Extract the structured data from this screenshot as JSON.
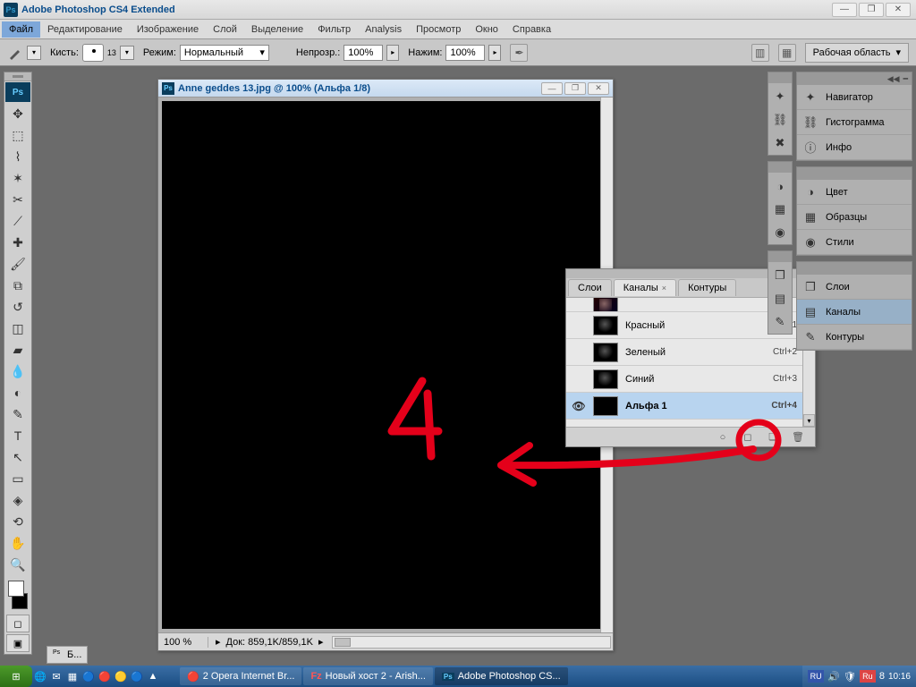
{
  "app": {
    "title": "Adobe Photoshop CS4 Extended"
  },
  "menu": [
    "Файл",
    "Редактирование",
    "Изображение",
    "Слой",
    "Выделение",
    "Фильтр",
    "Analysis",
    "Просмотр",
    "Окно",
    "Справка"
  ],
  "options": {
    "brush_label": "Кисть:",
    "brush_size": "13",
    "mode_label": "Режим:",
    "mode_value": "Нормальный",
    "opacity_label": "Непрозр.:",
    "opacity_value": "100%",
    "flow_label": "Нажим:",
    "flow_value": "100%",
    "workspace": "Рабочая область"
  },
  "doc": {
    "title": "Anne geddes 13.jpg @ 100% (Альфа 1/8)",
    "zoom": "100 %",
    "info": "Док: 859,1K/859,1K"
  },
  "right_panels": {
    "g1": [
      {
        "icon": "✦",
        "label": "Навигатор"
      },
      {
        "icon": "⛓",
        "label": "Гистограмма"
      },
      {
        "icon": "ⓘ",
        "label": "Инфо"
      }
    ],
    "g2": [
      {
        "icon": "◑",
        "label": "Цвет"
      },
      {
        "icon": "▦",
        "label": "Образцы"
      },
      {
        "icon": "◉",
        "label": "Стили"
      }
    ],
    "g3": [
      {
        "icon": "❐",
        "label": "Слои",
        "sel": false
      },
      {
        "icon": "▤",
        "label": "Каналы",
        "sel": true
      },
      {
        "icon": "✎",
        "label": "Контуры",
        "sel": false
      }
    ]
  },
  "channels": {
    "tabs": [
      "Слои",
      "Каналы",
      "Контуры"
    ],
    "active_tab": 1,
    "rows": [
      {
        "eye": "",
        "name": "Красный",
        "shortcut": "Ctrl+1",
        "sel": false
      },
      {
        "eye": "",
        "name": "Зеленый",
        "shortcut": "Ctrl+2",
        "sel": false
      },
      {
        "eye": "",
        "name": "Синий",
        "shortcut": "Ctrl+3",
        "sel": false
      },
      {
        "eye": "👁",
        "name": "Альфа 1",
        "shortcut": "Ctrl+4",
        "sel": true
      }
    ]
  },
  "taskbar": {
    "items": [
      {
        "icon": "🌐",
        "label": "2 Opera Internet Br...",
        "active": false
      },
      {
        "icon": "Fz",
        "label": "Новый хост 2 - Arish...",
        "active": false
      },
      {
        "icon": "Ps",
        "label": "Adobe Photoshop CS...",
        "active": true
      }
    ],
    "lang1": "RU",
    "lang2": "Ru",
    "clock": "10:16"
  },
  "mini_tab": "Б..."
}
